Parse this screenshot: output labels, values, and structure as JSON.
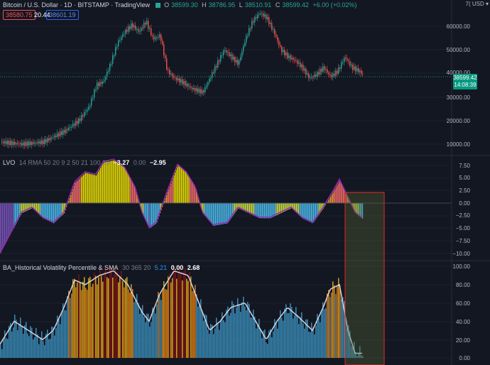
{
  "header": {
    "symbol": "Bitcoin / U.S. Dollar · 1D · BITSTAMP · TradingView",
    "open_label": "O",
    "open": "38599.30",
    "high_label": "H",
    "high": "38786.95",
    "low_label": "L",
    "low": "38510.91",
    "close_label": "C",
    "close": "38599.42",
    "change": "+6.00 (+0.02%)",
    "currency": "USD",
    "axis_cut": "7("
  },
  "badges": {
    "left": "38580.75",
    "mid": "20.44",
    "right": "38601.19"
  },
  "price_axis": {
    "ticks": [
      "60000.00",
      "50000.00",
      "40000.00",
      "30000.00",
      "20000.00",
      "10000.00"
    ],
    "last_price": "38599.42",
    "countdown": "14:08:39"
  },
  "lvo": {
    "legend": "LVO",
    "params": "14 RMA 50 20 9 2 50 21 100 20",
    "v1": "−3.27",
    "v2": "0.00",
    "v3": "−2.95",
    "ticks": [
      "7.50",
      "5.00",
      "2.50",
      "0.00",
      "−2.50",
      "−5.00",
      "−7.50",
      "−10.00"
    ]
  },
  "hvp": {
    "legend": "BA_Historical Volatility Percentile & SMA",
    "params": "30 365 20",
    "v1": "5.21",
    "v2": "0.00",
    "v3": "2.68",
    "ticks": [
      "100.00",
      "80.00",
      "60.00",
      "40.00",
      "20.00",
      "0.00"
    ]
  },
  "colors": {
    "background": "#131722",
    "bull": "#26a69a",
    "bear": "#ef5350",
    "highlight_box": "#c62828"
  }
}
